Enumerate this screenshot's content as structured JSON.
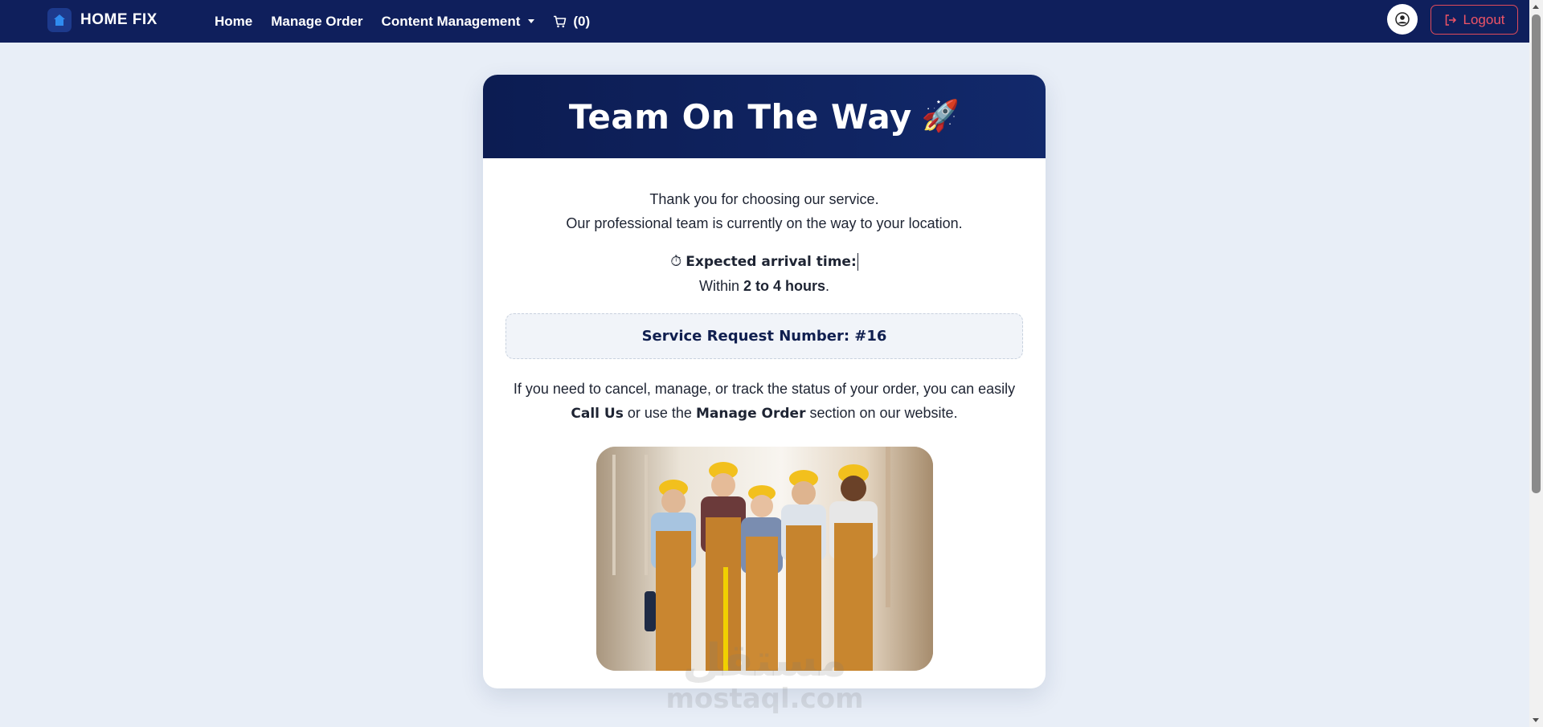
{
  "navbar": {
    "brand_name": "HOME FIX",
    "links": [
      {
        "label": "Home"
      },
      {
        "label": "Manage Order"
      },
      {
        "label": "Content Management"
      }
    ],
    "cart_count": "(0)",
    "logout_label": "Logout"
  },
  "card": {
    "title": "Team On The Way",
    "title_emoji": "🚀",
    "intro_line1": "Thank you for choosing our service.",
    "intro_line2": "Our professional team is currently on the way to your location.",
    "arrival_icon": "⏱",
    "arrival_label": "Expected arrival time:",
    "arrival_prefix": "Within",
    "arrival_value": "2 to 4 hours",
    "arrival_suffix": ".",
    "request_number": "Service Request Number: #16",
    "help_part1": "If you need to cancel, manage, or track the status of your order, you can easily",
    "help_call": "Call Us",
    "help_part2": "or use the",
    "help_manage": "Manage Order",
    "help_part3": "section on our website."
  },
  "watermark": {
    "logo_text": "مستقل",
    "site_text": "mostaql.com"
  },
  "colors": {
    "navbar_bg": "#0f1f5c",
    "page_bg": "#e8eef7",
    "logout_red": "#ef5466",
    "header_bg": "#0c1c52"
  },
  "icons": {
    "brand": "house-icon",
    "cart": "cart-icon",
    "user": "user-circle-icon",
    "logout": "logout-icon",
    "arrival": "stopwatch-icon"
  }
}
